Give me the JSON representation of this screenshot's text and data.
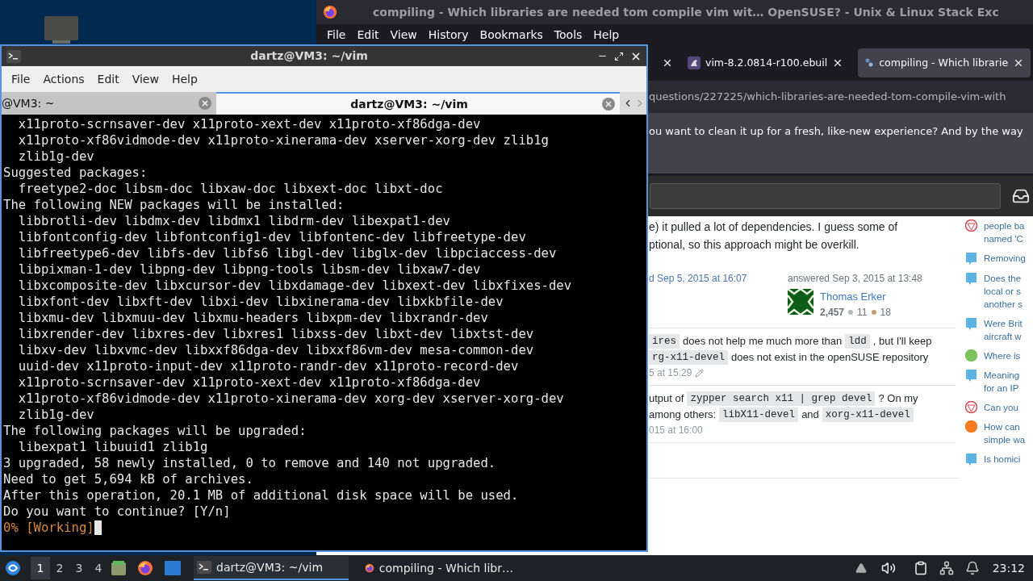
{
  "browser": {
    "title": "compiling - Which libraries are needed tom compile vim wit…  OpenSUSE? - Unix & Linux Stack Exc",
    "menu": [
      "File",
      "Edit",
      "View",
      "History",
      "Bookmarks",
      "Tools",
      "Help"
    ],
    "tabs": [
      {
        "label": "vim-8.2.0814-r100.ebuil",
        "selected": false,
        "kind": "ebuild"
      },
      {
        "label": "compiling - Which librarie",
        "selected": true,
        "kind": "stack"
      }
    ],
    "url": "questions/227225/which-libraries-are-needed-tom-compile-vim-with",
    "notification": "ou want to clean it up for a fresh, like-new experience? And by the way",
    "post": {
      "lines": [
        "e) it pulled a lot of dependencies. I guess some of",
        "ptional, so this approach might be overkill."
      ],
      "edited": "d Sep 5, 2015 at 16:07",
      "answered": "answered Sep 3, 2015 at 13:48",
      "user": {
        "name": "Thomas Erker",
        "reputation": "2,457",
        "badges": [
          {
            "count": "11",
            "color": "#b4b8bc"
          },
          {
            "count": "18",
            "color": "#c69c6d"
          }
        ]
      }
    },
    "comments": [
      {
        "lines": [
          [
            {
              "kind": "code",
              "text": "ires"
            },
            {
              "kind": "text",
              "text": "does not help me much more than"
            },
            {
              "kind": "code",
              "text": "ldd"
            },
            {
              "kind": "text",
              "text": ", but I'll keep"
            }
          ],
          [
            {
              "kind": "code",
              "text": "rg-x11-devel"
            },
            {
              "kind": "text",
              "text": "does not exist in the openSUSE repository"
            }
          ]
        ],
        "time": "5 at 15:29",
        "edited": true
      },
      {
        "lines": [
          [
            {
              "kind": "text",
              "text": "utput of"
            },
            {
              "kind": "code",
              "text": "zypper search x11 | grep devel"
            },
            {
              "kind": "text",
              "text": "? On my"
            }
          ],
          [
            {
              "kind": "text",
              "text": "among others:"
            },
            {
              "kind": "code",
              "text": "libX11-devel"
            },
            {
              "kind": "text",
              "text": "and"
            },
            {
              "kind": "code",
              "text": "xorg-x11-devel"
            }
          ]
        ],
        "time": "015 at 16:00",
        "edited": false
      }
    ],
    "sidebar": [
      {
        "kind": "red",
        "lines": [
          "people ba",
          "named 'C"
        ]
      },
      {
        "kind": "blue",
        "lines": [
          "Removing"
        ]
      },
      {
        "kind": "blue",
        "lines": [
          "Does the",
          "local or s",
          "another s"
        ]
      },
      {
        "kind": "blue",
        "lines": [
          "Were Brit",
          "aircraft w"
        ]
      },
      {
        "kind": "green",
        "lines": [
          "Where is"
        ]
      },
      {
        "kind": "blue",
        "lines": [
          "Meaning",
          "for an IP"
        ]
      },
      {
        "kind": "red",
        "lines": [
          "Can you"
        ]
      },
      {
        "kind": "orange",
        "lines": [
          "How can",
          "simple wa"
        ]
      },
      {
        "kind": "blue",
        "lines": [
          "Is homici"
        ]
      }
    ]
  },
  "terminal": {
    "title": "dartz@VM3: ~/vim",
    "menu": [
      "File",
      "Actions",
      "Edit",
      "View",
      "Help"
    ],
    "tabs": [
      {
        "label": "@VM3: ~",
        "selected": false
      },
      {
        "label": "dartz@VM3: ~/vim",
        "selected": true
      }
    ],
    "lines": [
      {
        "kind": "output",
        "text": "  x11proto-scrnsaver-dev x11proto-xext-dev x11proto-xf86dga-dev"
      },
      {
        "kind": "output",
        "text": "  x11proto-xf86vidmode-dev x11proto-xinerama-dev xserver-xorg-dev zlib1g"
      },
      {
        "kind": "output",
        "text": "  zlib1g-dev"
      },
      {
        "kind": "output",
        "text": "Suggested packages:"
      },
      {
        "kind": "output",
        "text": "  freetype2-doc libsm-doc libxaw-doc libxext-doc libxt-doc"
      },
      {
        "kind": "output",
        "text": "The following NEW packages will be installed:"
      },
      {
        "kind": "output",
        "text": "  libbrotli-dev libdmx-dev libdmx1 libdrm-dev libexpat1-dev"
      },
      {
        "kind": "output",
        "text": "  libfontconfig-dev libfontconfig1-dev libfontenc-dev libfreetype-dev"
      },
      {
        "kind": "output",
        "text": "  libfreetype6-dev libfs-dev libfs6 libgl-dev libglx-dev libpciaccess-dev"
      },
      {
        "kind": "output",
        "text": "  libpixman-1-dev libpng-dev libpng-tools libsm-dev libxaw7-dev"
      },
      {
        "kind": "output",
        "text": "  libxcomposite-dev libxcursor-dev libxdamage-dev libxext-dev libxfixes-dev"
      },
      {
        "kind": "output",
        "text": "  libxfont-dev libxft-dev libxi-dev libxinerama-dev libxkbfile-dev"
      },
      {
        "kind": "output",
        "text": "  libxmu-dev libxmuu-dev libxmu-headers libxpm-dev libxrandr-dev"
      },
      {
        "kind": "output",
        "text": "  libxrender-dev libxres-dev libxres1 libxss-dev libxt-dev libxtst-dev"
      },
      {
        "kind": "output",
        "text": "  libxv-dev libxvmc-dev libxxf86dga-dev libxxf86vm-dev mesa-common-dev"
      },
      {
        "kind": "output",
        "text": "  uuid-dev x11proto-input-dev x11proto-randr-dev x11proto-record-dev"
      },
      {
        "kind": "output",
        "text": "  x11proto-scrnsaver-dev x11proto-xext-dev x11proto-xf86dga-dev"
      },
      {
        "kind": "output",
        "text": "  x11proto-xf86vidmode-dev x11proto-xinerama-dev xorg-dev xserver-xorg-dev"
      },
      {
        "kind": "output",
        "text": "  zlib1g-dev"
      },
      {
        "kind": "output",
        "text": "The following packages will be upgraded:"
      },
      {
        "kind": "output",
        "text": "  libexpat1 libuuid1 zlib1g"
      },
      {
        "kind": "output",
        "text": "3 upgraded, 58 newly installed, 0 to remove and 140 not upgraded."
      },
      {
        "kind": "output",
        "text": "Need to get 5,694 kB of archives."
      },
      {
        "kind": "output",
        "text": "After this operation, 20.1 MB of additional disk space will be used."
      },
      {
        "kind": "output",
        "text": "Do you want to continue? [Y/n]"
      },
      {
        "kind": "progress",
        "text": "0% [Working]"
      }
    ]
  },
  "taskbar": {
    "workspaces": [
      {
        "label": "1",
        "selected": true
      },
      {
        "label": "2",
        "selected": false
      },
      {
        "label": "3",
        "selected": false
      },
      {
        "label": "4",
        "selected": false
      }
    ],
    "tasks": [
      {
        "kind": "terminal",
        "label": "dartz@VM3: ~/vim",
        "selected": true
      },
      {
        "kind": "browser",
        "label": "compiling - Which libr…",
        "selected": false
      }
    ],
    "clock": "23:12"
  }
}
